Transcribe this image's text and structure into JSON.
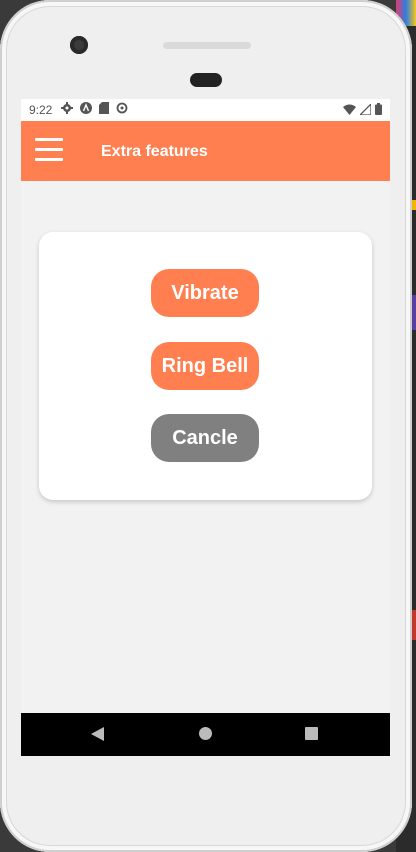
{
  "status_bar": {
    "time": "9:22",
    "left_icons": [
      "gear-icon",
      "a-icon",
      "sd-card-icon",
      "sync-icon"
    ],
    "right_icons": [
      "wifi-icon",
      "signal-icon",
      "battery-icon"
    ]
  },
  "app_bar": {
    "title": "Extra features",
    "menu_icon": "hamburger-menu-icon",
    "color": "#ff7f50"
  },
  "card": {
    "buttons": [
      {
        "label": "Vibrate",
        "color": "#ff7f50"
      },
      {
        "label": "Ring Bell",
        "color": "#ff7f50"
      },
      {
        "label": "Cancle",
        "color": "#808080"
      }
    ]
  },
  "nav_bar": {
    "icons": [
      "back-icon",
      "home-icon",
      "recents-icon"
    ]
  }
}
